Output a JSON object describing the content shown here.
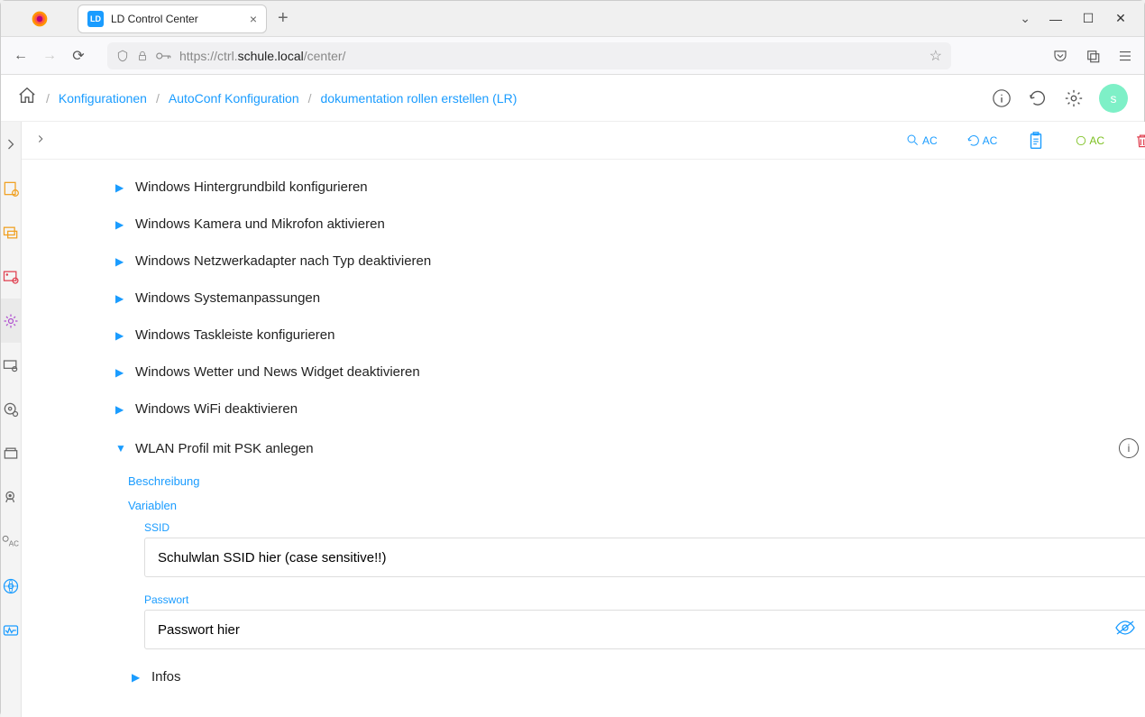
{
  "browser": {
    "tab_title": "LD Control Center",
    "tab_favicon": "LD",
    "url_prefix": "https://ctrl.",
    "url_domain": "schule.local",
    "url_path": "/center/"
  },
  "breadcrumb": {
    "b1": "Konfigurationen",
    "b2": "AutoConf Konfiguration",
    "b3": "dokumentation rollen erstellen (LR)",
    "avatar": "s"
  },
  "tree": {
    "i0": "Windows Hintergrundbild konfigurieren",
    "i1": "Windows Kamera und Mikrofon aktivieren",
    "i2": "Windows Netzwerkadapter nach Typ deaktivieren",
    "i3": "Windows Systemanpassungen",
    "i4": "Windows Taskleiste konfigurieren",
    "i5": "Windows Wetter und News Widget deaktivieren",
    "i6": "Windows WiFi deaktivieren",
    "i7": "WLAN Profil mit PSK anlegen",
    "i8": "Infos"
  },
  "section": {
    "desc": "Beschreibung",
    "vars": "Variablen",
    "ssid_label": "SSID",
    "ssid_value": "Schulwlan SSID hier (case sensitive!!)",
    "pw_label": "Passwort",
    "pw_value": "Passwort hier"
  },
  "toolbar": {
    "ac": "AC"
  }
}
